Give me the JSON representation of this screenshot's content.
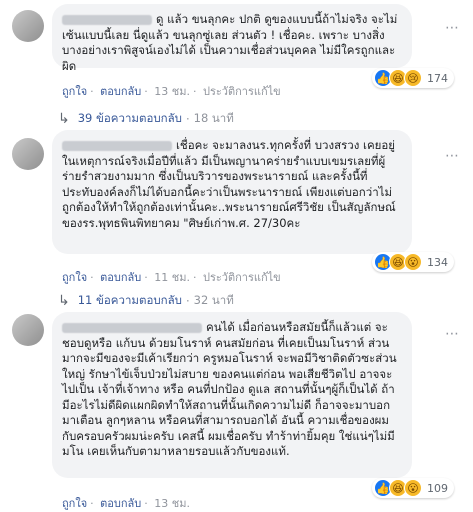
{
  "comments": [
    {
      "text": "ดู แล้ว ขนลุกคะ ปกติ ดูของแบบนี้ถ้าไม่จริง จะไม่เซ้นแบบนี้เลย นี่ดูแล้ว ขนลุกซู่เลย ส่วนตัว ! เชื่อคะ. เพราะ บางสิ่งบางอย่างเราพิสูจน์เองไม่ได้ เป็นความเชื่อส่วนบุคคล ไม่มีใครถูกและผิด",
      "reaction_icons": [
        "like-icon",
        "haha-icon",
        "sad-icon"
      ],
      "reaction_count": "174",
      "actions": {
        "like": "ถูกใจ",
        "reply": "ตอบกลับ",
        "time": "13 ชม.",
        "edited": "ประวัติการแก้ไข"
      },
      "replies": {
        "count_label": "39 ข้อความตอบกลับ",
        "time": "18 นาที"
      }
    },
    {
      "text": "เชื่อคะ จะมาลงนร.ทุกครั้งที่ บวงสรวง เคยอยู่ในเหตุการณ์จริงเมื่อปีที่แล้ว มีเป็นพญานาคร่ายรำแบบเขมรเลยที่ผู้ร่ายรำสวยงามมาก ซึ่งเป็นบริวารของพระนารายณ์ และครั้งนี้ที่ประทับองค์ลงก็ไม่ได้บอกนี้คะว่าเป็นพระนารายณ์ เพียงแต่บอกว่าไม่ถูกต้องให้ทำให้ถูกต้องเท่านั้นคะ..พระนารายณ์ศรีวิชัย เป็นสัญลักษณ์ของรร.พุทธพินพิทยาคม \"ศิษย์เก่าพ.ศ. 27/30คะ",
      "reaction_icons": [
        "like-icon",
        "haha-icon",
        "wow-icon"
      ],
      "reaction_count": "134",
      "actions": {
        "like": "ถูกใจ",
        "reply": "ตอบกลับ",
        "time": "11 ชม.",
        "edited": "ประวัติการแก้ไข"
      },
      "replies": {
        "count_label": "11 ข้อความตอบกลับ",
        "time": "32 นาที"
      }
    },
    {
      "text": "คนได้ เมื่อก่อนหรือสมัยนี้ก็แล้วแต่ จะชอบดูหรือ แก้บน ด้วยมโนราห์ คนสมัยก่อน ที่เคยเป็นมโนราห์ ส่วนมากจะมีของจะมีเค้าเรียกว่า ครูหมอโนราห์ จะพอมีวิชาติดตัวซะส่วนใหญ่ รักษาไข้เจ็บป่วยไม่สบาย ของคนแต่ก่อน พอเสียชีวิตไป อาจจะไปเป็น เจ้าที่เจ้าทาง หรือ คนที่ปกป้อง ดูแล สถานที่นั้นๆผู้ก็เป็นได้ ถ้ามีอะไรไม่ดีผิดแผกผิดทำให้สถานที่นั้นเกิดความไม่ดี ก็อาจจะมาบอกมาเตือน ลูกๆหลาน หรือคนที่สามารถบอกได้ อันนี้ ความเชื่อของผม กับครอบครัวผมน่ะครับ เคสนี้ ผมเชื่อครับ ทำร้าท่ายิ้มคุย ใช่แน่ๆไม่มีมโน เคยเห็นกับตามาหลายรอบแล้วกับของแท้.",
      "reaction_icons": [
        "like-icon",
        "haha-icon",
        "wow-icon"
      ],
      "reaction_count": "109",
      "actions": {
        "like": "ถูกใจ",
        "reply": "ตอบกลับ",
        "time": "13 ชม.",
        "edited": ""
      },
      "replies": null
    }
  ],
  "colors": {
    "link": "#385898",
    "muted": "#90949c",
    "bubble": "#f2f3f5",
    "like_blue": "#1877f2"
  },
  "menu_icon": "more-dots-icon"
}
